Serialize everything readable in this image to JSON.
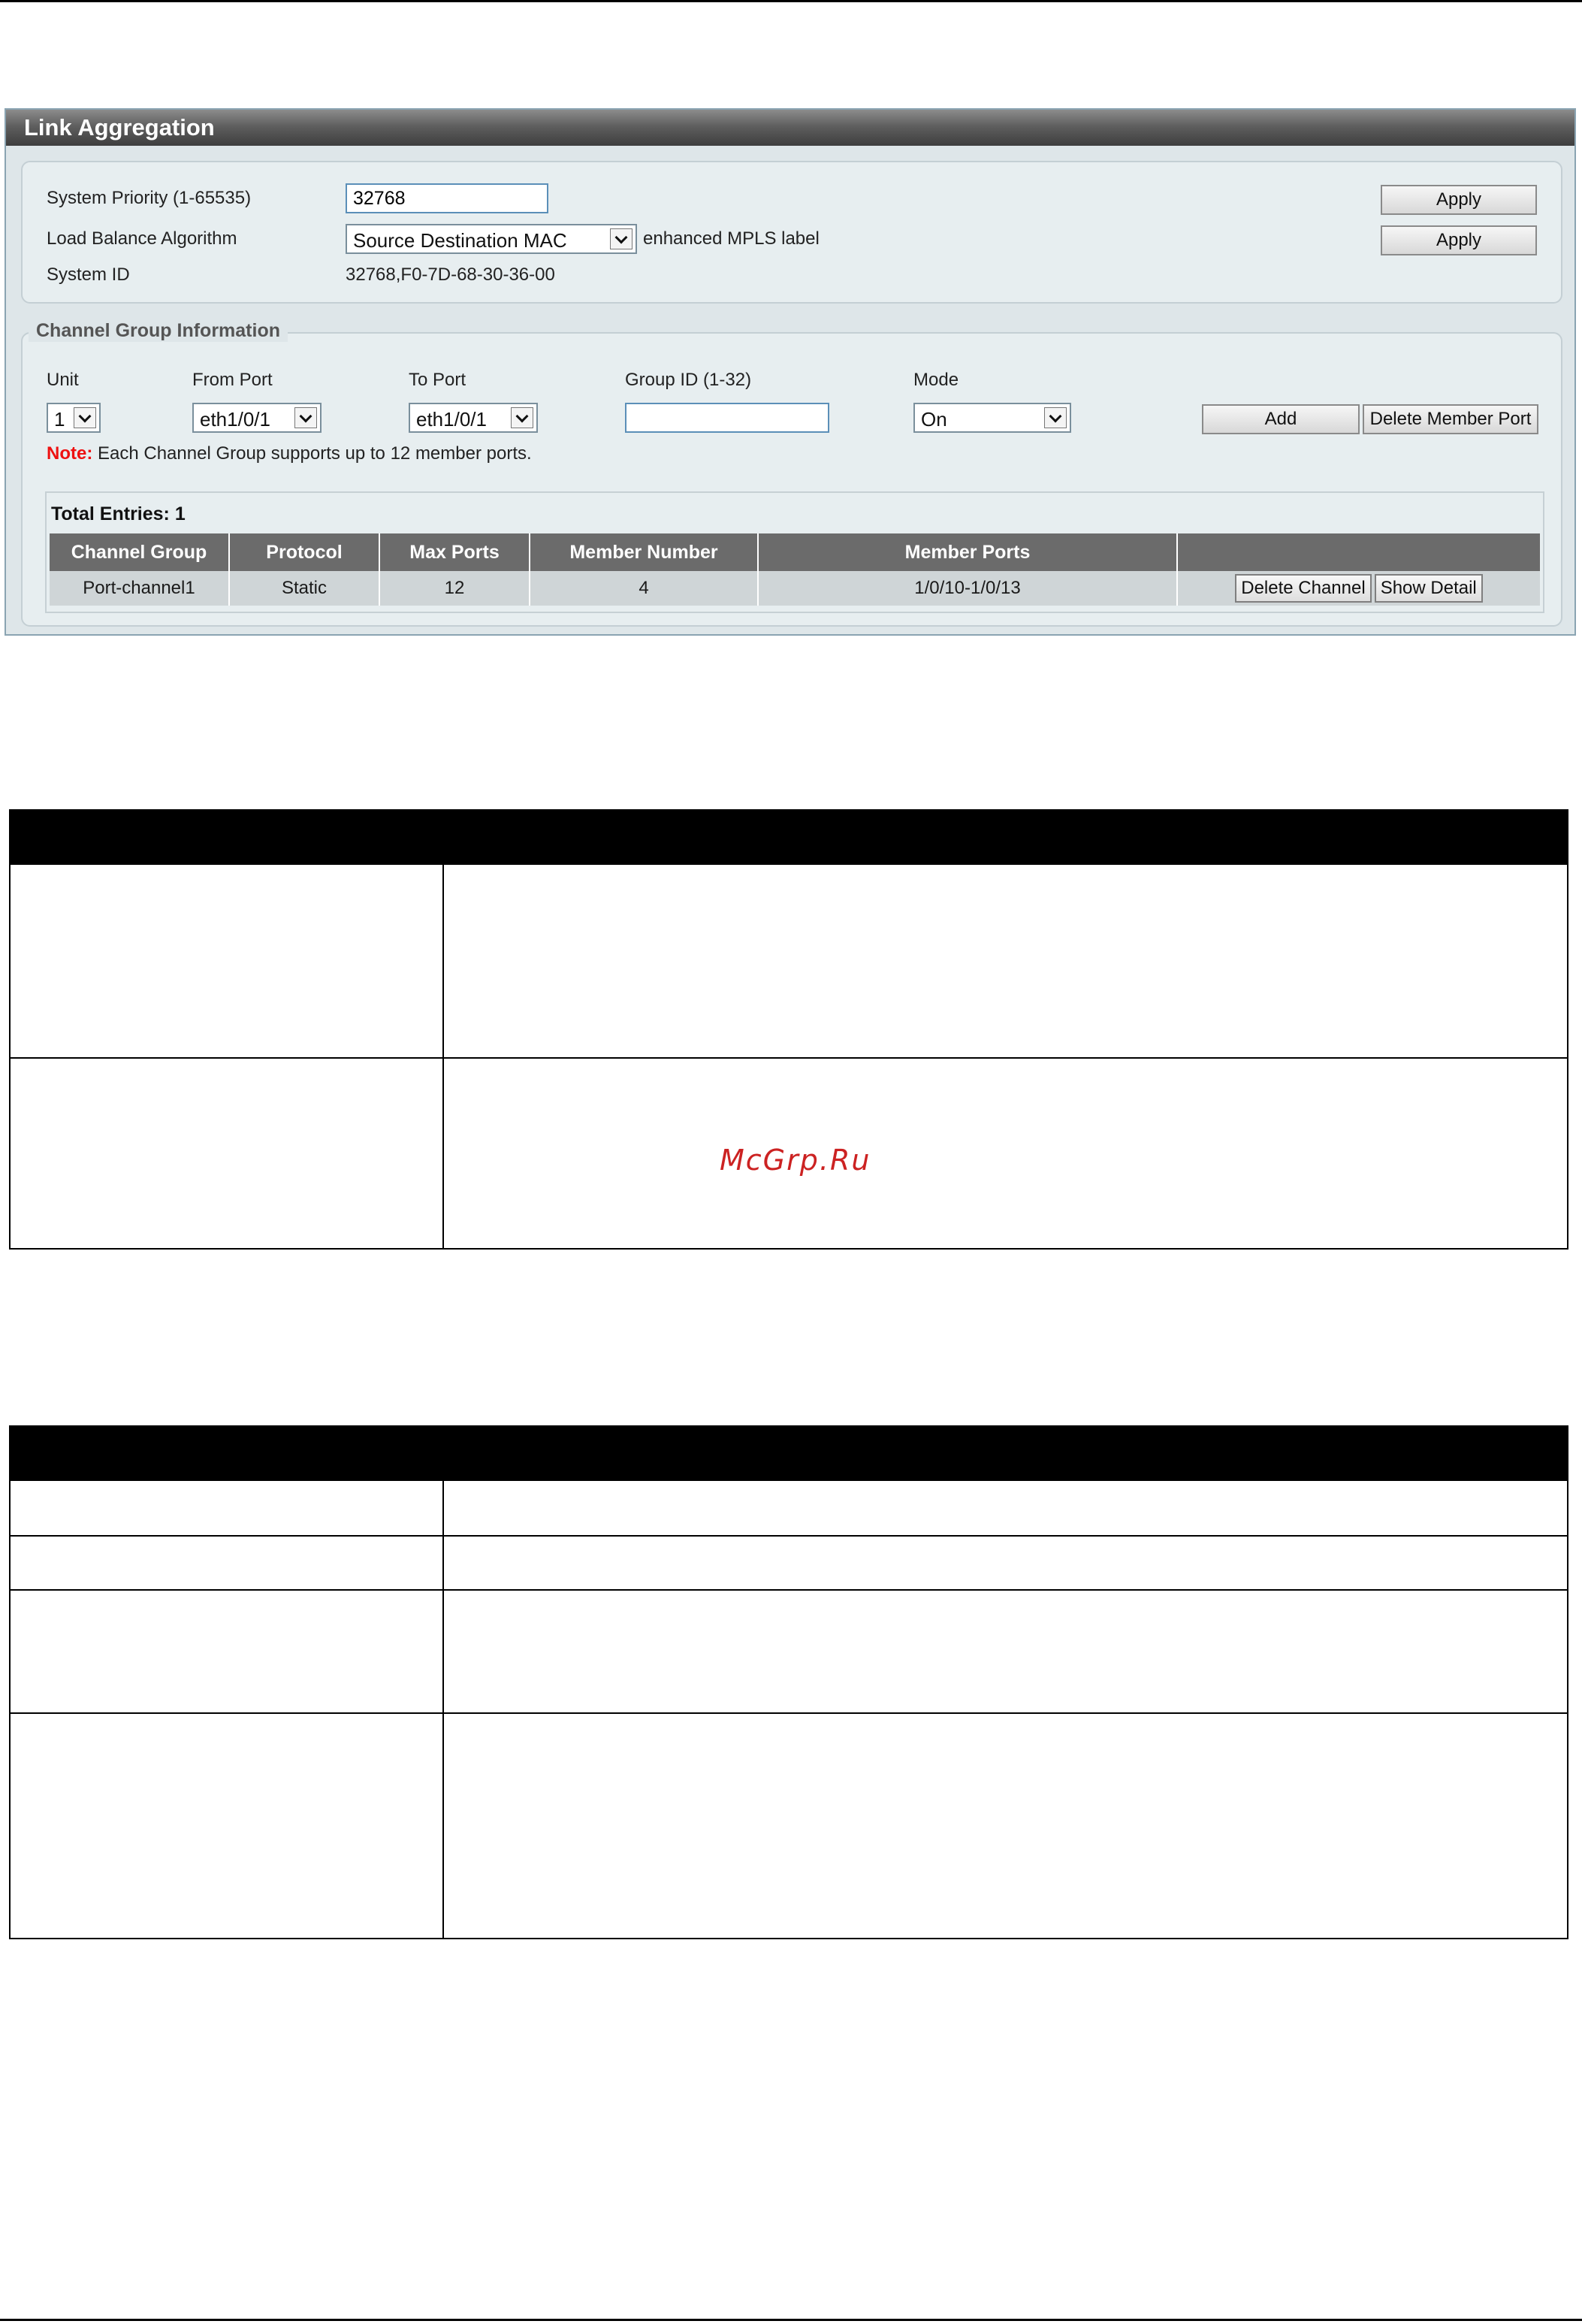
{
  "panel": {
    "title": "Link Aggregation",
    "system": {
      "priority_label": "System Priority (1-65535)",
      "priority_value": "32768",
      "algorithm_label": "Load Balance Algorithm",
      "algorithm_value": "Source Destination MAC",
      "algorithm_extra": "enhanced MPLS label",
      "system_id_label": "System ID",
      "system_id_value": "32768,F0-7D-68-30-36-00",
      "apply_label": "Apply"
    },
    "channel_group": {
      "legend": "Channel Group Information",
      "unit_label": "Unit",
      "unit_value": "1",
      "from_port_label": "From Port",
      "from_port_value": "eth1/0/1",
      "to_port_label": "To Port",
      "to_port_value": "eth1/0/1",
      "group_id_label": "Group ID (1-32)",
      "group_id_value": "",
      "mode_label": "Mode",
      "mode_value": "On",
      "add_label": "Add",
      "delete_member_label": "Delete Member Port",
      "note_prefix": "Note:",
      "note_text": " Each Channel Group supports up to 12 member ports."
    },
    "entries": {
      "total_label": "Total Entries: 1",
      "columns": [
        "Channel Group",
        "Protocol",
        "Max Ports",
        "Member Number",
        "Member Ports",
        ""
      ],
      "rows": [
        {
          "channel_group": "Port-channel1",
          "protocol": "Static",
          "max_ports": "12",
          "member_number": "4",
          "member_ports": "1/0/10-1/0/13",
          "delete_label": "Delete Channel",
          "detail_label": "Show Detail"
        }
      ]
    }
  },
  "watermark": "McGrp.Ru",
  "colors": {
    "title_bar": "#5f5f5f",
    "panel_bg": "#dee6e9",
    "table_header": "#6b6b6b",
    "note_red": "#ee1111",
    "watermark": "#cc2222"
  }
}
